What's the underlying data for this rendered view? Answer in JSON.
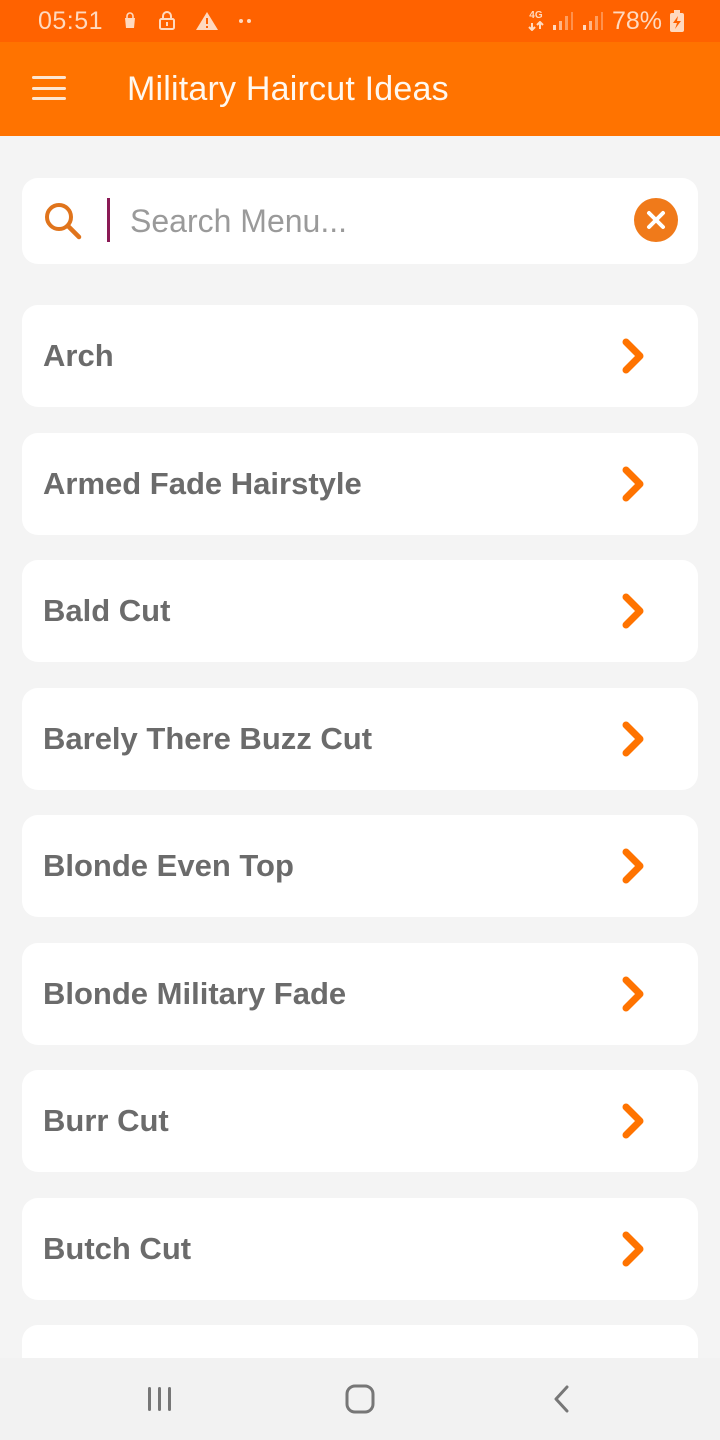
{
  "status_bar": {
    "time": "05:51",
    "notification_icons": [
      "shopping-bag-icon",
      "lock-icon",
      "warning-icon",
      "more-dots-icon"
    ],
    "network_type": "4G",
    "battery_percent": "78%",
    "battery_charging": true
  },
  "app_bar": {
    "title": "Military Haircut Ideas",
    "menu_icon": "hamburger-menu-icon"
  },
  "search": {
    "value": "",
    "placeholder": "Search Menu...",
    "search_icon": "search-icon",
    "clear_icon": "clear-icon"
  },
  "list": {
    "items": [
      {
        "label": "Arch"
      },
      {
        "label": "Armed Fade Hairstyle"
      },
      {
        "label": "Bald Cut"
      },
      {
        "label": "Barely There Buzz Cut"
      },
      {
        "label": "Blonde Even Top"
      },
      {
        "label": "Blonde Military Fade"
      },
      {
        "label": "Burr Cut"
      },
      {
        "label": "Butch Cut"
      },
      {
        "label": ""
      }
    ]
  },
  "nav_bar": {
    "recents_icon": "recents-icon",
    "home_icon": "home-icon",
    "back_icon": "back-icon"
  },
  "colors": {
    "status_bar": "#ff6200",
    "app_bar": "#ff7300",
    "accent": "#f07a1a",
    "chevron": "#ff7300",
    "item_text": "#6b6b6b",
    "background": "#f4f4f4"
  }
}
